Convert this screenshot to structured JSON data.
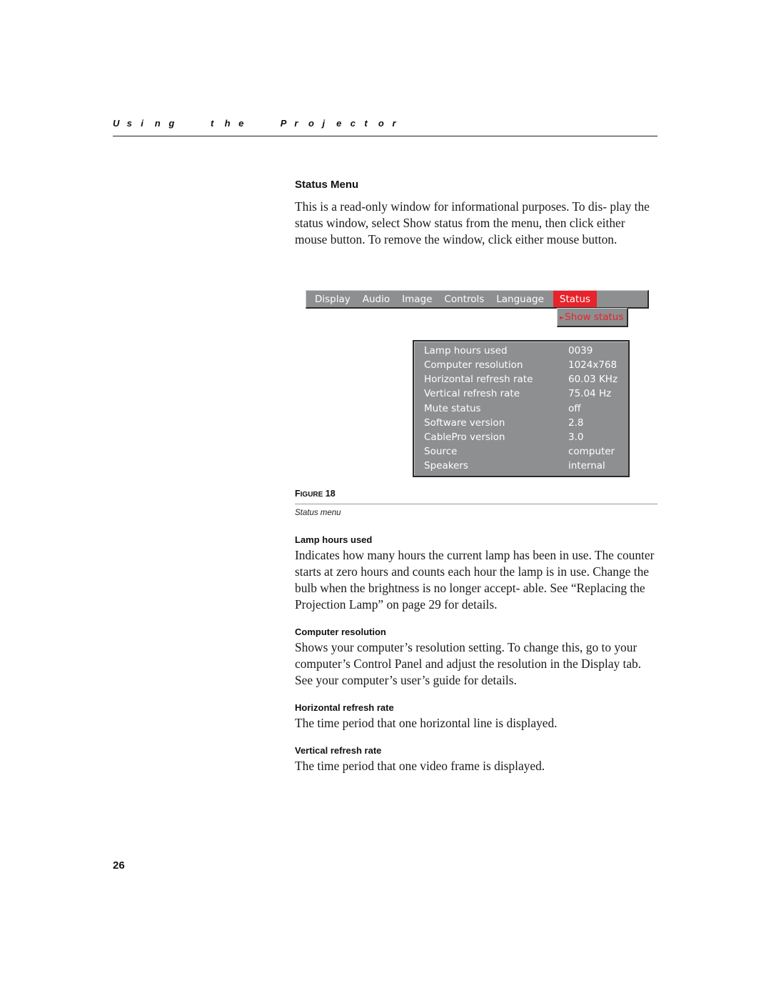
{
  "running_head": "Using the Projector",
  "section": {
    "title": "Status Menu",
    "intro": "This is a read-only window for informational purposes. To dis- play the status window, select Show status from the menu, then click either mouse button. To remove the window, click either mouse button."
  },
  "projector_menu": {
    "tabs": [
      "Display",
      "Audio",
      "Image",
      "Controls",
      "Language",
      "Status"
    ],
    "active_tab": "Status",
    "submenu_item": "Show status",
    "submenu_arrow_icon": "arrow-right-icon",
    "colors": {
      "menu_bg": "#8e8f91",
      "active": "#e8232c",
      "text": "#ffffff"
    }
  },
  "status_window": {
    "rows": [
      {
        "label": "Lamp hours used",
        "value": "0039"
      },
      {
        "label": "Computer resolution",
        "value": "1024x768"
      },
      {
        "label": "Horizontal refresh rate",
        "value": "60.03 KHz"
      },
      {
        "label": "Vertical refresh rate",
        "value": "75.04 Hz"
      },
      {
        "label": "Mute status",
        "value": "off"
      },
      {
        "label": "Software version",
        "value": "2.8"
      },
      {
        "label": "CablePro version",
        "value": "3.0"
      },
      {
        "label": "Source",
        "value": "computer"
      },
      {
        "label": "Speakers",
        "value": "internal"
      }
    ]
  },
  "figure": {
    "label_prefix": "F",
    "label_smallcaps": "IGURE",
    "number": "18",
    "caption": "Status menu"
  },
  "descriptions": [
    {
      "title": "Lamp hours used",
      "text": "Indicates how many hours the current lamp has been in use. The counter starts at zero hours and counts each hour the lamp is in use. Change the bulb when the brightness is no longer accept- able. See “Replacing the Projection Lamp” on page 29 for details."
    },
    {
      "title": "Computer resolution",
      "text": "Shows your computer’s resolution setting. To change this, go to your computer’s Control Panel and adjust the resolution in the Display tab. See your computer’s user’s guide for details."
    },
    {
      "title": "Horizontal refresh rate",
      "text": "The time period that one horizontal line is displayed."
    },
    {
      "title": "Vertical refresh rate",
      "text": "The time period that one video frame is displayed."
    }
  ],
  "page_number": "26"
}
